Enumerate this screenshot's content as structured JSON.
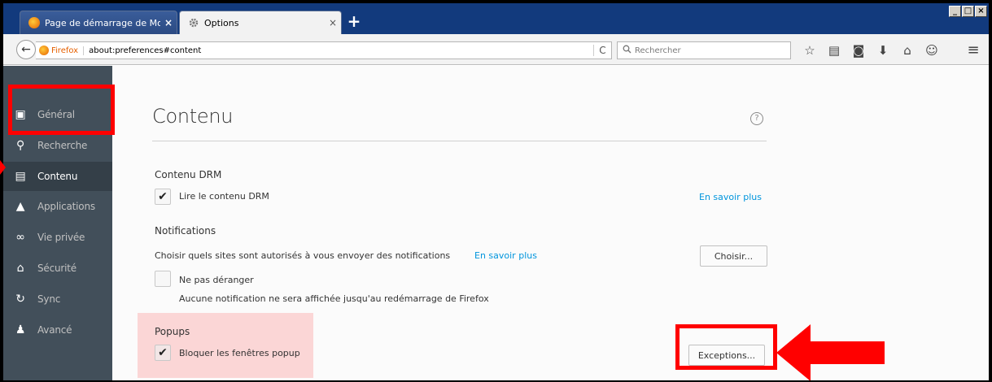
{
  "tabs": [
    {
      "title": "Page de démarrage de Mozilla...",
      "close": "×"
    },
    {
      "title": "Options",
      "close": "×"
    }
  ],
  "new_tab": "+",
  "window_controls": [
    "_",
    "□",
    "×"
  ],
  "navbar": {
    "back": "←",
    "identity_label": "Firefox",
    "url": "about:preferences#content",
    "reload": "C",
    "search_placeholder": "Rechercher",
    "toolbar_icons": [
      "star-icon",
      "reading-list-icon",
      "pocket-icon",
      "download-icon",
      "home-icon",
      "chat-icon"
    ],
    "menu": "≡"
  },
  "sidebar": {
    "items": [
      {
        "label": "Général",
        "icon": "general-icon"
      },
      {
        "label": "Recherche",
        "icon": "search-icon"
      },
      {
        "label": "Contenu",
        "icon": "content-icon"
      },
      {
        "label": "Applications",
        "icon": "applications-icon"
      },
      {
        "label": "Vie privée",
        "icon": "privacy-icon"
      },
      {
        "label": "Sécurité",
        "icon": "security-icon"
      },
      {
        "label": "Sync",
        "icon": "sync-icon"
      },
      {
        "label": "Avancé",
        "icon": "advanced-icon"
      }
    ],
    "selected_index": 2
  },
  "main": {
    "title": "Contenu",
    "help": "?",
    "drm": {
      "heading": "Contenu DRM",
      "checkbox_label": "Lire le contenu DRM",
      "checked": true,
      "link": "En savoir plus"
    },
    "notifications": {
      "heading": "Notifications",
      "description": "Choisir quels sites sont autorisés à vous envoyer des notifications",
      "link": "En savoir plus",
      "button": "Choisir...",
      "dnd_label": "Ne pas déranger",
      "dnd_checked": false,
      "dnd_note": "Aucune notification ne sera affichée jusqu'au redémarrage de Firefox"
    },
    "popups": {
      "heading": "Popups",
      "checkbox_label": "Bloquer les fenêtres popup",
      "checked": true,
      "button": "Exceptions..."
    }
  },
  "colors": {
    "tabbar": "#123a7d",
    "sidebar": "#424f5a",
    "sidebar_selected": "#343f48",
    "link": "#0095dd",
    "highlight": "#ff0000",
    "popups_bg": "#fbd6d6"
  }
}
